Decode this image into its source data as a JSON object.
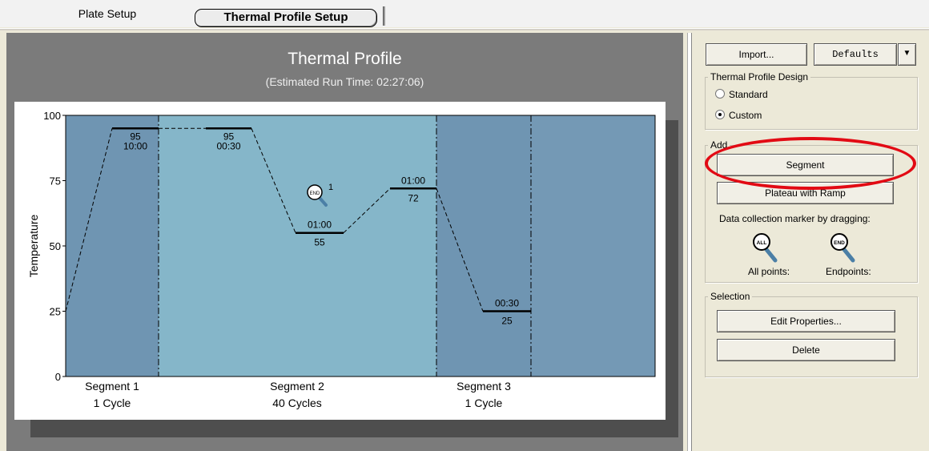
{
  "tabs": {
    "plate_setup": "Plate Setup",
    "thermal_profile_setup": "Thermal Profile Setup"
  },
  "main": {
    "title": "Thermal Profile",
    "subtitle": "(Estimated Run Time: 02:27:06)"
  },
  "chart_data": {
    "type": "line",
    "ylabel": "Temperature",
    "xlabel": "",
    "ylim": [
      0,
      100
    ],
    "yticks": [
      "0",
      "25",
      "50",
      "75",
      "100"
    ],
    "segments": [
      {
        "name": "Segment 1",
        "cycles": "1 Cycle"
      },
      {
        "name": "Segment 2",
        "cycles": "40 Cycles"
      },
      {
        "name": "Segment 3",
        "cycles": "1 Cycle"
      }
    ],
    "steps": [
      {
        "temp": 95,
        "temp_label": "95",
        "time": "10:00",
        "segment": 1
      },
      {
        "temp": 95,
        "temp_label": "95",
        "time": "00:30",
        "segment": 2
      },
      {
        "temp": 55,
        "temp_label": "55",
        "time": "01:00",
        "segment": 2
      },
      {
        "temp": 72,
        "temp_label": "72",
        "time": "01:00",
        "segment": 2
      },
      {
        "temp": 25,
        "temp_label": "25",
        "time": "00:30",
        "segment": 3
      }
    ],
    "start_temp": 25,
    "end_marker": {
      "label": "END",
      "count": "1"
    },
    "colors": {
      "segment_1_bg": "#6f95b2",
      "segment_2_bg": "#85b6c9",
      "segment_3_bg": "#6f95b2",
      "trailing_bg": "#7499b5",
      "axis_bg": "#ffffff",
      "line": "#000000"
    }
  },
  "sidebar": {
    "import_label": "Import...",
    "defaults_label": "Defaults",
    "design_group": {
      "title": "Thermal Profile Design",
      "standard_label": "Standard",
      "custom_label": "Custom",
      "selected": "Custom"
    },
    "add_group": {
      "title": "Add",
      "segment_label": "Segment",
      "plateau_label": "Plateau with Ramp",
      "marker_text": "Data collection marker by dragging:",
      "all_points_label": "All points:",
      "endpoints_label": "Endpoints:",
      "all_icon_text": "ALL",
      "end_icon_text": "END"
    },
    "selection_group": {
      "title": "Selection",
      "edit_label": "Edit Properties...",
      "delete_label": "Delete"
    }
  }
}
